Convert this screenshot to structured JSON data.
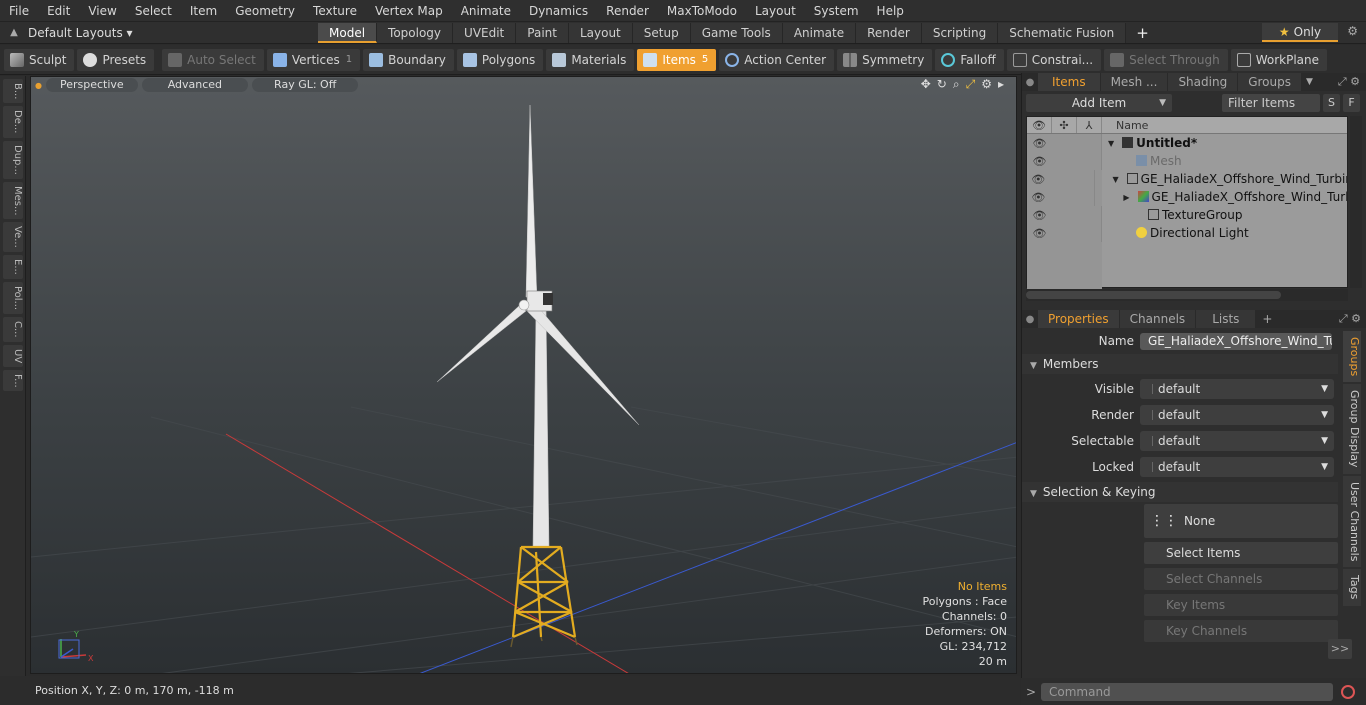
{
  "menu": [
    "File",
    "Edit",
    "View",
    "Select",
    "Item",
    "Geometry",
    "Texture",
    "Vertex Map",
    "Animate",
    "Dynamics",
    "Render",
    "MaxToModo",
    "Layout",
    "System",
    "Help"
  ],
  "layout": {
    "name": "Default Layouts ▾",
    "only": "Only"
  },
  "tabs": [
    "Model",
    "Topology",
    "UVEdit",
    "Paint",
    "Layout",
    "Setup",
    "Game Tools",
    "Animate",
    "Render",
    "Scripting",
    "Schematic Fusion"
  ],
  "active_tab": "Model",
  "toolbar": {
    "sculpt": "Sculpt",
    "presets": "Presets",
    "auto_select": "Auto Select",
    "vertices": "Vertices",
    "vertices_count": "1",
    "boundary": "Boundary",
    "polygons": "Polygons",
    "materials": "Materials",
    "items": "Items",
    "items_count": "5",
    "action_center": "Action Center",
    "symmetry": "Symmetry",
    "falloff": "Falloff",
    "constraints": "Constrai...",
    "select_through": "Select Through",
    "workplane": "WorkPlane"
  },
  "left_tabs": [
    "B...",
    "De...",
    "Dup...",
    "Mes...",
    "Ve...",
    "E...",
    "Pol...",
    "C...",
    "UV",
    "F..."
  ],
  "viewport": {
    "perspective": "Perspective",
    "advanced": "Advanced",
    "raygl": "Ray GL: Off",
    "stats": {
      "no_items": "No Items",
      "polygons": "Polygons : Face",
      "channels": "Channels: 0",
      "deformers": "Deformers: ON",
      "gl": "GL: 234,712",
      "scale": "20 m"
    }
  },
  "status": {
    "position": "Position X, Y, Z:   0 m, 170 m, -118 m"
  },
  "items_panel": {
    "tabs": [
      "Items",
      "Mesh ...",
      "Shading",
      "Groups"
    ],
    "add_item": "Add Item",
    "filter": "Filter Items",
    "s": "S",
    "f": "F",
    "name_header": "Name",
    "rows": [
      {
        "label": "Untitled*"
      },
      {
        "label": "Mesh"
      },
      {
        "label": "GE_HaliadeX_Offshore_Wind_Turbine..."
      },
      {
        "label": "GE_HaliadeX_Offshore_Wind_Turbi..."
      },
      {
        "label": "TextureGroup"
      },
      {
        "label": "Directional Light"
      }
    ]
  },
  "properties": {
    "tabs": [
      "Properties",
      "Channels",
      "Lists"
    ],
    "name_label": "Name",
    "name_value": "GE_HaliadeX_Offshore_Wind_Turbine",
    "members": "Members",
    "visible": "Visible",
    "render": "Render",
    "selectable": "Selectable",
    "locked": "Locked",
    "default": "default",
    "selection_keying": "Selection & Keying",
    "none": "None",
    "select_items": "Select Items",
    "select_channels": "Select Channels",
    "key_items": "Key Items",
    "key_channels": "Key Channels",
    "expand": ">>",
    "side_tabs": [
      "Groups",
      "Group Display",
      "User Channels",
      "Tags"
    ]
  },
  "command": {
    "placeholder": "Command"
  },
  "colors": {
    "accent": "#f0a030",
    "axis_x": "#c83a3a",
    "axis_z": "#3a5ad0",
    "tower": "#e8e8e8",
    "jacket": "#e8b020"
  }
}
